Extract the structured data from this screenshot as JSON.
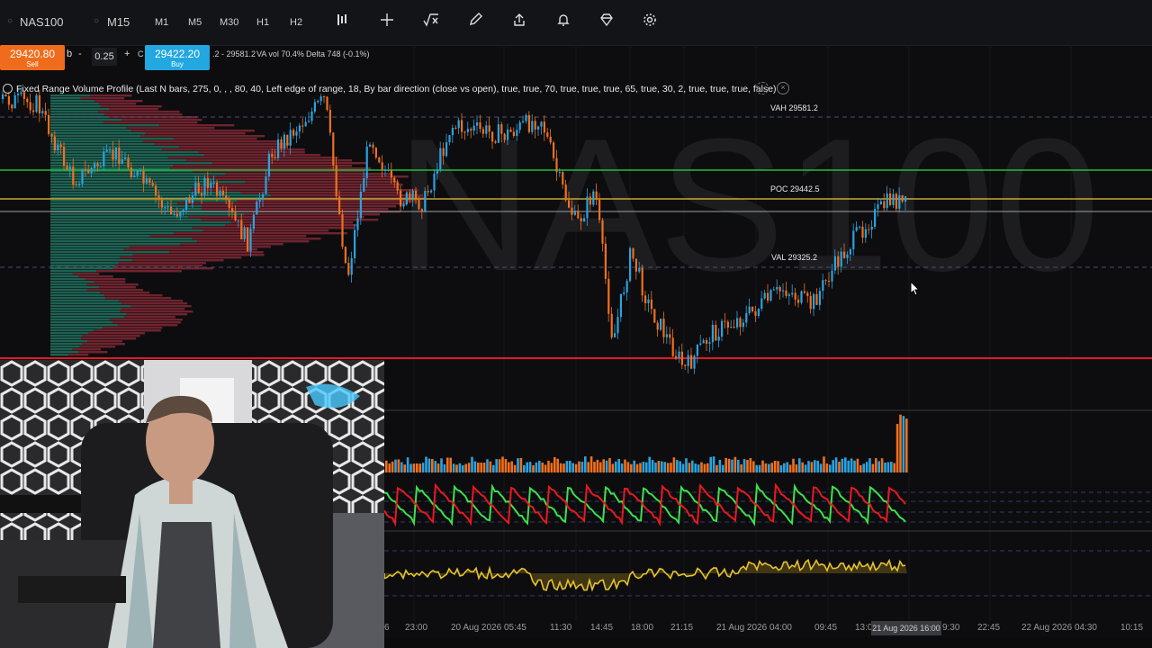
{
  "toolbar": {
    "symbol": "NAS100",
    "timeframe": "M15",
    "intervals": [
      "M1",
      "M5",
      "M30",
      "H1",
      "H2"
    ],
    "icons": [
      "indicators-icon",
      "crosshair-icon",
      "formula-icon",
      "pencil-icon",
      "share-icon",
      "alert-bell-icon",
      "diamond-icon",
      "settings-icon"
    ]
  },
  "trade": {
    "sell_price": "29420.80",
    "sell_label": "Sell",
    "buy_price": "29422.20",
    "buy_label": "Buy",
    "minus": "-",
    "plus": "+",
    "quantity": "0.25",
    "partial_left": "b",
    "partial_c": "C",
    "range": ".2 - 29581.2",
    "va_vol": "VA vol 70.4%",
    "delta": "Delta 748 (-0.1%)"
  },
  "indicator": {
    "text": "Fixed Range Volume Profile (Last N bars, 275, 0, , , 80, 40, Left edge of range, 18, By bar direction (close vs open), true, true, 70, true, true, true, 65, true, 30, 2, true, true, true, false)"
  },
  "levels": {
    "vah": "VAH 29581.2",
    "poc": "POC 29442.5",
    "val": "VAL 29325.2"
  },
  "watermark": "NAS100",
  "x_axis": {
    "labels": [
      "6",
      "23:00",
      "20 Aug 2026 05:45",
      "11:30",
      "14:45",
      "18:00",
      "21:15",
      "21 Aug 2026 04:00",
      "09:45",
      "13:0",
      "9:30",
      "22:45",
      "22 Aug 2026 04:30",
      "10:15"
    ],
    "highlight": "21 Aug 2026 16:00"
  },
  "colors": {
    "bull": "#2aa3e0",
    "bear": "#f0701e",
    "poc_line": "#e8c53a",
    "green_line": "#1fbf3a",
    "red_line": "#e01b24",
    "osc_green": "#3ee04a",
    "osc_red": "#e8191f",
    "yellow_osc": "#e5c22d"
  }
}
